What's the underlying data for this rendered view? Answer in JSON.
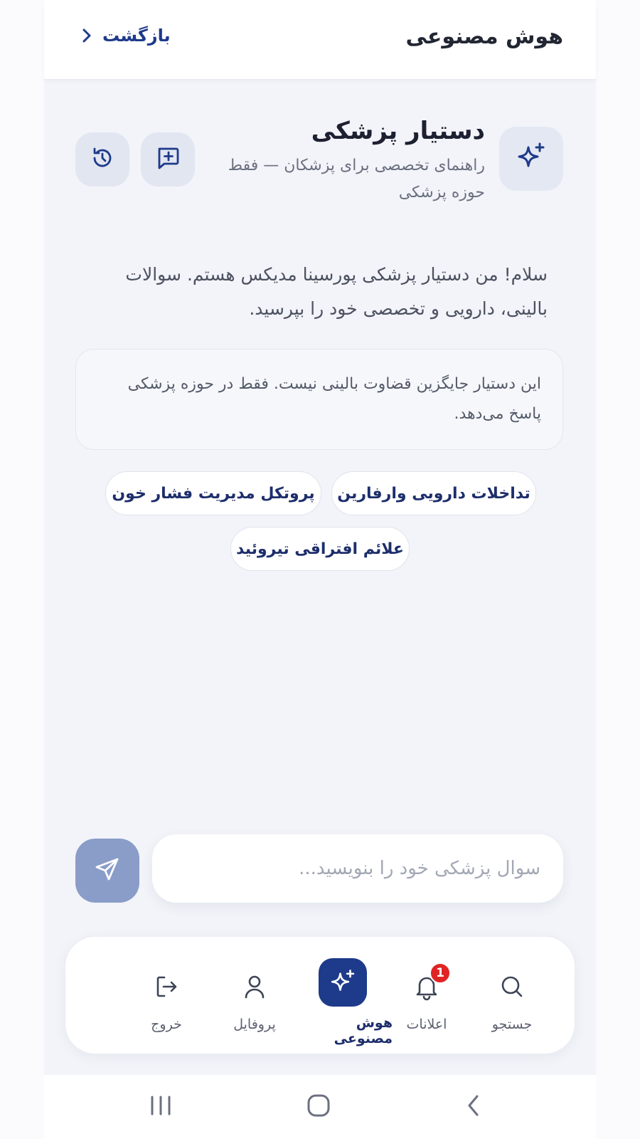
{
  "header": {
    "title": "هوش مصنوعی",
    "back_label": "بازگشت"
  },
  "assistant": {
    "name": "دستیار پزشکی",
    "subtitle": "راهنمای تخصصی برای پزشکان — فقط حوزه پزشکی",
    "welcome": "سلام! من دستیار پزشکی پورسینا مدیکس هستم. سوالات بالینی، دارویی و تخصصی خود را بپرسید.",
    "notice": "این دستیار جایگزین قضاوت بالینی نیست. فقط در حوزه پزشکی پاسخ می‌دهد."
  },
  "suggestions": [
    "تداخلات دارویی وارفارین",
    "پروتکل مدیریت فشار خون",
    "علائم افتراقی تیروئید"
  ],
  "composer": {
    "placeholder": "سوال پزشکی خود را بنویسید...",
    "value": ""
  },
  "bottom_nav": {
    "items": [
      {
        "label": "جستجو",
        "icon": "search-icon"
      },
      {
        "label": "اعلانات",
        "icon": "bell-icon",
        "badge": "1"
      },
      {
        "label": "هوش مصنوعی",
        "icon": "sparkles-icon",
        "active": true
      },
      {
        "label": "پروفایل",
        "icon": "user-icon"
      },
      {
        "label": "خروج",
        "icon": "logout-icon"
      }
    ]
  },
  "colors": {
    "primary": "#1e3a8a",
    "send_button": "#8a9cc8",
    "badge": "#e02424",
    "background": "#f2f4f9"
  }
}
